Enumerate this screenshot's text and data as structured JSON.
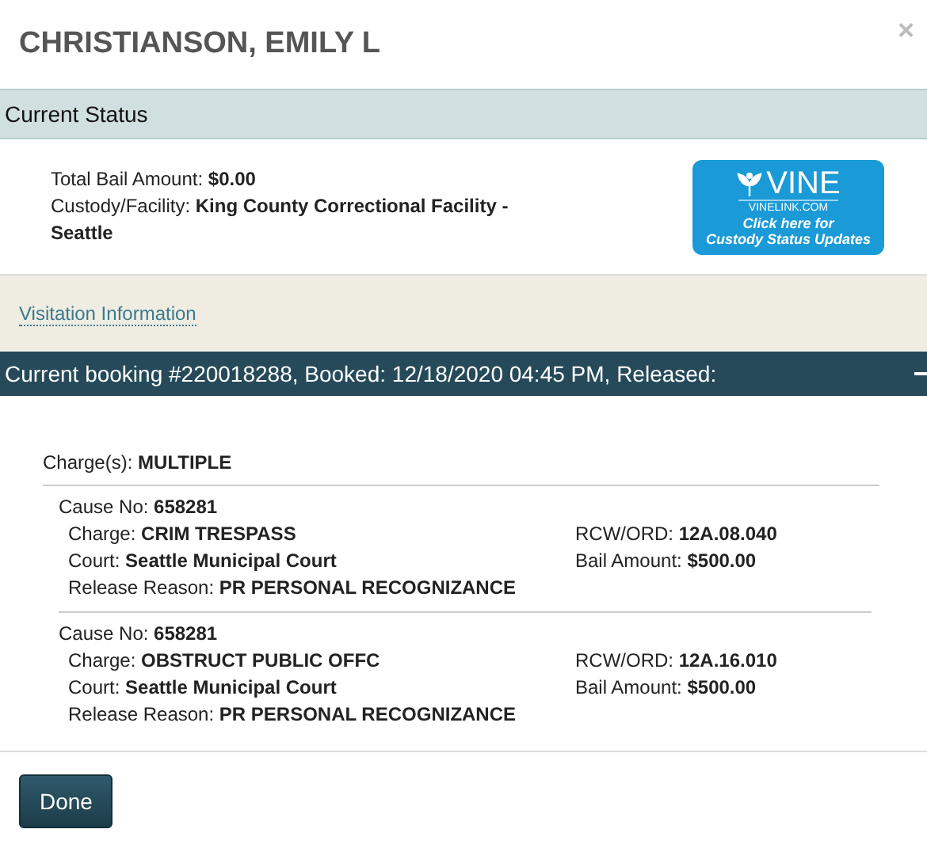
{
  "dialog": {
    "title": "CHRISTIANSON, EMILY L",
    "close": "×"
  },
  "status": {
    "heading": "Current Status",
    "lines": [
      "Total Bail Amount: **$0.00**",
      "Custody/Facility: **King County Correctional Facility - Seattle**"
    ],
    "vine": {
      "brand": "VINE",
      "site": "VINELINK.COM",
      "lines": [
        "Click here for",
        "Custody Status Updates"
      ]
    }
  },
  "visitation_link": "Visitation Information",
  "booking": {
    "heading": "Current booking #220018288, Booked: 12/18/2020 04:45 PM, Released:",
    "expanded": true,
    "charges_summary": "Charge(s): **MULTIPLE**",
    "charges": [
      {
        "cause": "Cause No: **658281**",
        "left": [
          "Charge: **CRIM TRESPASS**",
          "Court: **Seattle Municipal Court**",
          "Release Reason: **PR PERSONAL RECOGNIZANCE**"
        ],
        "right": [
          "RCW/ORD: **12A.08.040**",
          "Bail Amount: **$500.00**"
        ]
      },
      {
        "cause": "Cause No: **658281**",
        "left": [
          "Charge: **OBSTRUCT PUBLIC OFFC**",
          "Court: **Seattle Municipal Court**",
          "Release Reason: **PR PERSONAL RECOGNIZANCE**"
        ],
        "right": [
          "RCW/ORD: **12A.16.010**",
          "Bail Amount: **$500.00**"
        ]
      }
    ]
  },
  "buttons": [
    "Done"
  ]
}
